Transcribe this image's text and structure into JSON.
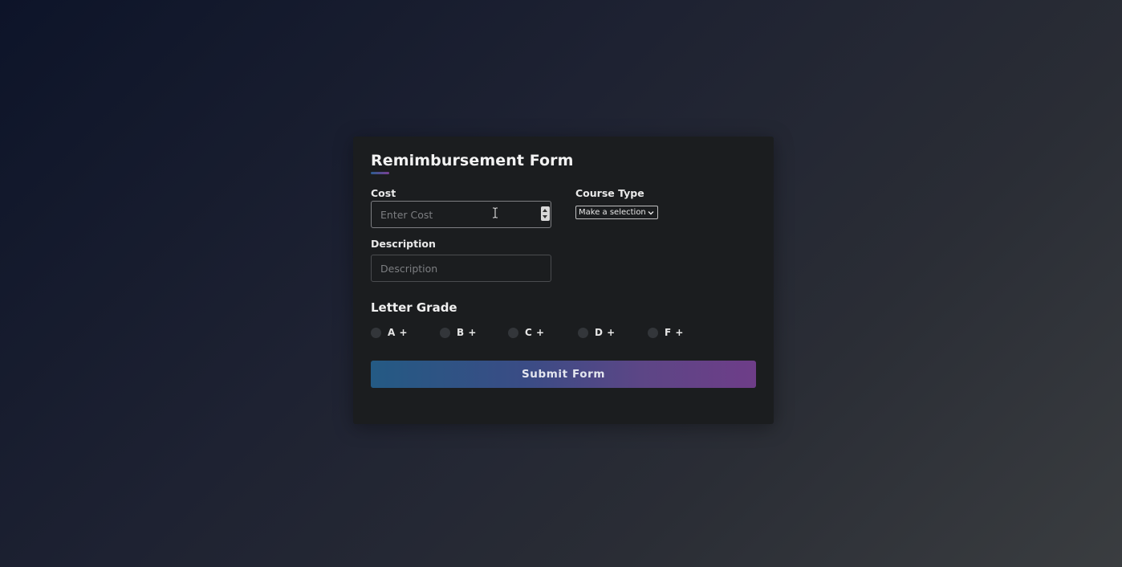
{
  "form": {
    "title": "Remimbursement Form",
    "cost": {
      "label": "Cost",
      "placeholder": "Enter Cost",
      "value": ""
    },
    "course_type": {
      "label": "Course Type",
      "selected": "Make a selection"
    },
    "description": {
      "label": "Description",
      "placeholder": "Description",
      "value": ""
    },
    "letter_grade": {
      "title": "Letter Grade",
      "options": [
        {
          "label": "A +",
          "checked": false
        },
        {
          "label": "B +",
          "checked": false
        },
        {
          "label": "C +",
          "checked": false
        },
        {
          "label": "D +",
          "checked": false
        },
        {
          "label": "F +",
          "checked": false
        }
      ]
    },
    "submit_label": "Submit Form"
  },
  "colors": {
    "card_background": "#1b1d1f",
    "button_gradient_start": "#245a84",
    "button_gradient_end": "#6e3d88"
  },
  "icons": {
    "stepper": "number-stepper-icon",
    "select": "chevron-down-icon",
    "cursor": "text-cursor-icon"
  }
}
